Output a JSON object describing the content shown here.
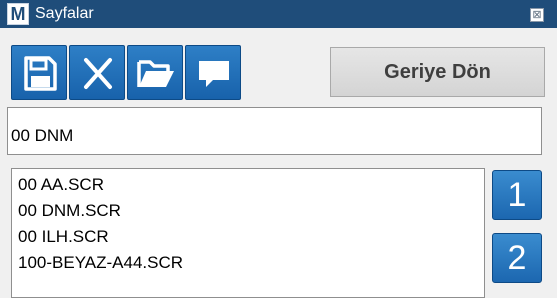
{
  "window": {
    "logo_letter": "M",
    "title": "Sayfalar",
    "close_glyph": "⊠"
  },
  "toolbar": {
    "buttons": [
      {
        "icon": "save-icon"
      },
      {
        "icon": "close-x-icon"
      },
      {
        "icon": "folder-open-icon"
      },
      {
        "icon": "comment-icon"
      }
    ],
    "back_label": "Geriye Dön"
  },
  "page_name": {
    "value": "00 DNM"
  },
  "file_list": {
    "items": [
      "00 AA.SCR",
      "00 DNM.SCR",
      "00 ILH.SCR",
      "100-BEYAZ-A44.SCR"
    ]
  },
  "page_buttons": [
    "1",
    "2"
  ],
  "colors": {
    "titlebar": "#1f4d7a",
    "accent_blue": "#1c67b0",
    "window_bg": "#f0f0f0"
  }
}
